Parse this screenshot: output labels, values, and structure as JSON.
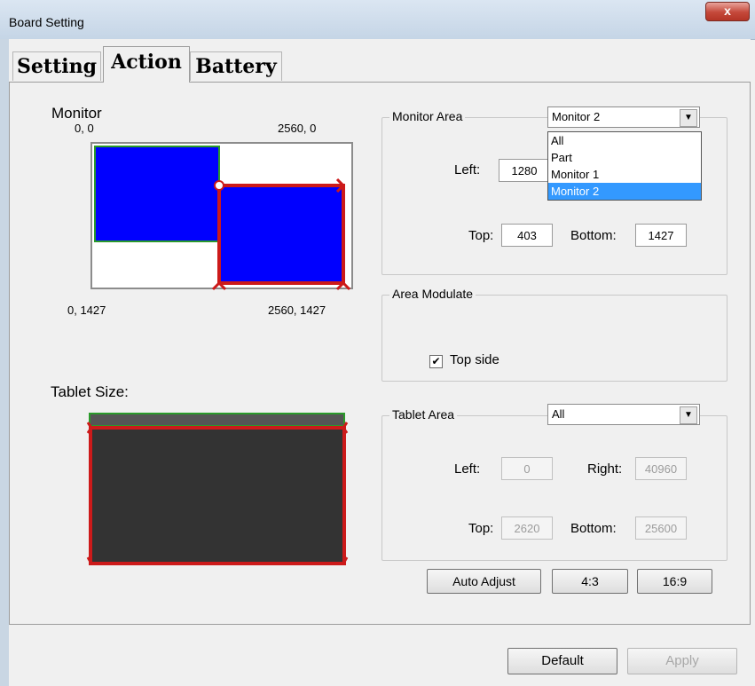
{
  "window": {
    "title": "Board Setting",
    "close_glyph": "x"
  },
  "tabs": [
    {
      "label": "Setting",
      "active": false
    },
    {
      "label": "Action",
      "active": true
    },
    {
      "label": "Battery",
      "active": false
    }
  ],
  "monitor": {
    "heading": "Monitor",
    "corners": {
      "top_left": "0,  0",
      "top_right": "2560,  0",
      "bottom_left": "0,  1427",
      "bottom_right": "2560,  1427"
    }
  },
  "tablet": {
    "heading": "Tablet Size:"
  },
  "monitor_area": {
    "label": "Monitor Area",
    "selected": "Monitor 2",
    "options": [
      "All",
      "Part",
      "Monitor 1",
      "Monitor 2"
    ],
    "left_label": "Left:",
    "left_value": "1280",
    "top_label": "Top:",
    "top_value": "403",
    "bottom_label": "Bottom:",
    "bottom_value": "1427"
  },
  "area_modulate": {
    "label": "Area Modulate",
    "top_side_label": "Top side",
    "top_side_checked": true
  },
  "tablet_area": {
    "label": "Tablet Area",
    "selected": "All",
    "left_label": "Left:",
    "left_value": "0",
    "right_label": "Right:",
    "right_value": "40960",
    "top_label": "Top:",
    "top_value": "2620",
    "bottom_label": "Bottom:",
    "bottom_value": "25600"
  },
  "buttons": {
    "auto_adjust": "Auto Adjust",
    "ratio_43": "4:3",
    "ratio_169": "16:9",
    "default": "Default",
    "apply": "Apply"
  },
  "colors": {
    "monitor_fill": "#0000ff",
    "active_border": "#cc1a1a",
    "green_border": "#2a9a2a",
    "tablet_fill": "#333333"
  }
}
